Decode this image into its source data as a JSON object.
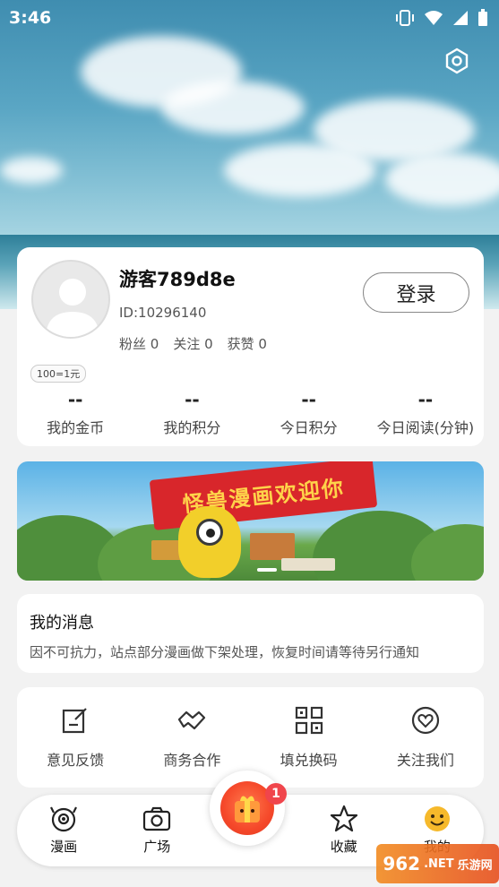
{
  "status_bar": {
    "time": "3:46"
  },
  "profile": {
    "username": "游客789d8e",
    "user_id": "ID:10296140",
    "stats": [
      "粉丝 0",
      "关注 0",
      "获赞 0"
    ],
    "login_label": "登录",
    "rate_badge": "100=1元",
    "metrics": [
      {
        "value": "--",
        "label": "我的金币"
      },
      {
        "value": "--",
        "label": "我的积分"
      },
      {
        "value": "--",
        "label": "今日积分"
      },
      {
        "value": "--",
        "label": "今日阅读(分钟)"
      }
    ]
  },
  "banner": {
    "flag_text": "怪兽漫画欢迎你"
  },
  "messages": {
    "title": "我的消息",
    "text": "因不可抗力，站点部分漫画做下架处理，恢复时间请等待另行通知"
  },
  "tools": [
    {
      "label": "意见反馈",
      "icon": "feedback-icon"
    },
    {
      "label": "商务合作",
      "icon": "handshake-icon"
    },
    {
      "label": "填兑换码",
      "icon": "qrcode-icon"
    },
    {
      "label": "关注我们",
      "icon": "heart-icon"
    }
  ],
  "tabbar": {
    "tabs": [
      {
        "label": "漫画",
        "icon": "monster-icon"
      },
      {
        "label": "广场",
        "icon": "camera-icon"
      },
      {
        "label": "",
        "icon": "gift-icon"
      },
      {
        "label": "收藏",
        "icon": "star-icon"
      },
      {
        "label": "我的",
        "icon": "smile-icon"
      }
    ],
    "center_badge": "1"
  },
  "watermark": {
    "text": "962",
    "suffix": ".NET",
    "sub": "乐游网"
  },
  "colors": {
    "accent": "#f0454c",
    "badge": "#f0454c",
    "banner_flag": "#d8262b"
  }
}
